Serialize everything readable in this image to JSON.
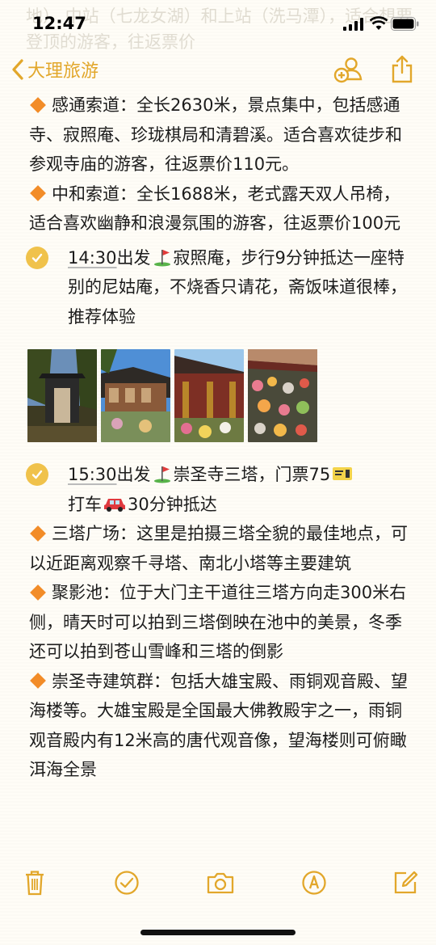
{
  "status": {
    "time": "12:47"
  },
  "faded_top_text": "地） 中站（七龙女湖）和上站（洗马潭），适合想要登顶的游客，往返票价",
  "nav": {
    "back_label": "大理旅游"
  },
  "content": {
    "p1": "感通索道：全长2630米，景点集中，包括感通寺、寂照庵、珍珑棋局和清碧溪。适合喜欢徒步和参观寺庙的游客，往返票价110元。",
    "p2": "中和索道：全长1688米，老式露天双人吊椅，适合喜欢幽静和浪漫氛围的游客，往返票价100元",
    "c1": {
      "time": "14:30",
      "text_a": "出发",
      "text_b": "寂照庵，步行9分钟抵达一座特别的尼姑庵，不烧香只请花，斋饭味道很棒，推荐体验"
    },
    "photos": [
      "temple-gate-photo",
      "temple-courtyard-photo",
      "temple-hall-photo",
      "flower-garden-photo"
    ],
    "c2": {
      "time": "15:30",
      "text_a": "出发",
      "text_b": "崇圣寺三塔，门票75",
      "text_c": "打车",
      "text_d": "30分钟抵达"
    },
    "p3": "三塔广场：这里是拍摄三塔全貌的最佳地点，可以近距离观察千寻塔、南北小塔等主要建筑",
    "p4": "聚影池：位于大门主干道往三塔方向走300米右侧，晴天时可以拍到三塔倒映在池中的美景，冬季还可以拍到苍山雪峰和三塔的倒影",
    "p5": "崇圣寺建筑群：包括大雄宝殿、雨铜观音殿、望海楼等。大雄宝殿是全国最大佛教殿宇之一，雨铜观音殿内有12米高的唐代观音像，望海楼则可俯瞰洱海全景"
  },
  "colors": {
    "accent": "#e2a72b",
    "diamond": "#f28c28",
    "check": "#f0c24b"
  }
}
